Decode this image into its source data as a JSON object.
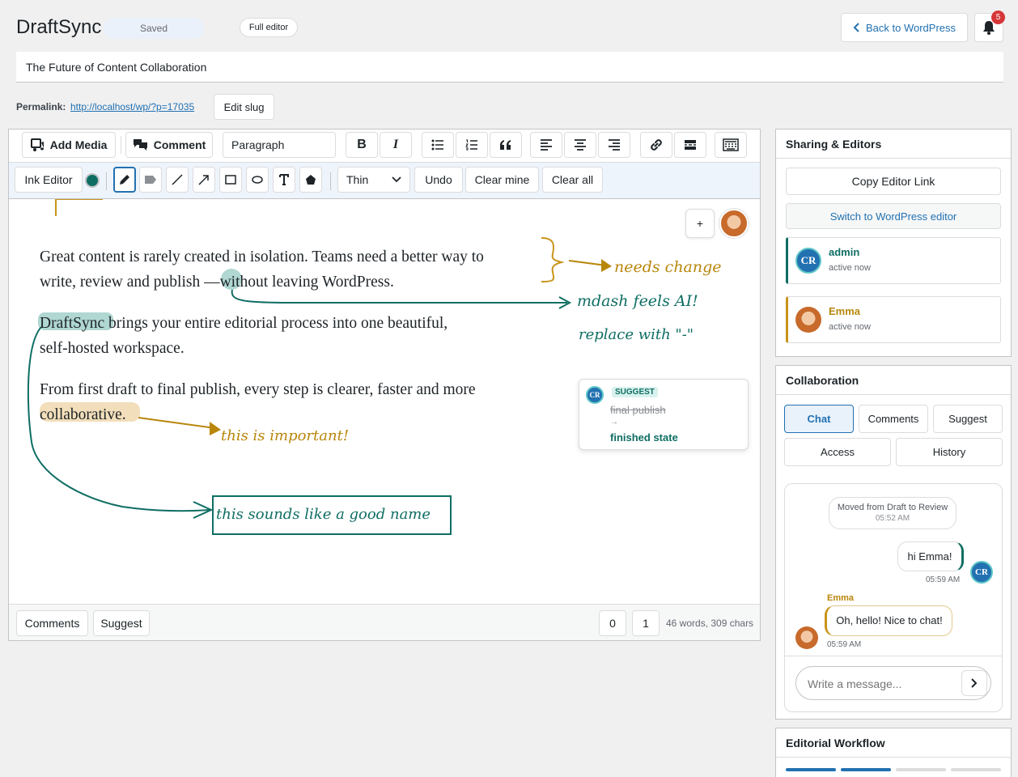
{
  "header": {
    "app_title": "DraftSync",
    "status_badge": "Saved",
    "full_editor_label": "Full editor",
    "back_label": "Back to WordPress",
    "notification_count": "5"
  },
  "post": {
    "title": "The Future of Content Collaboration",
    "permalink_label": "Permalink:",
    "permalink_url": "http://localhost/wp/?p=17035",
    "edit_slug_label": "Edit slug"
  },
  "toolbar": {
    "add_media": "Add Media",
    "comment": "Comment",
    "format_select": "Paragraph"
  },
  "ink_toolbar": {
    "ink_editor_label": "Ink Editor",
    "ink_color": "#0f6e63",
    "stroke_select": "Thin",
    "undo_label": "Undo",
    "clear_mine_label": "Clear mine",
    "clear_all_label": "Clear all"
  },
  "editor": {
    "paragraphs": [
      "Great content is rarely created in isolation. Teams need a better way to",
      "write, review and publish",
      "—",
      "without leaving WordPress.",
      "DraftSync",
      "brings your entire editorial process into one beautiful,",
      "self-hosted workspace.",
      "From first draft to final publish, every step is clearer, faster and more",
      "collaborative."
    ],
    "annotations": {
      "needs_change": "needs change",
      "mdash": "mdash feels AI!",
      "replace": "replace with \"-\"",
      "important": "this is important!",
      "good_name": "this sounds like a good name"
    },
    "plus_label": "+",
    "suggest_card": {
      "badge": "SUGGEST",
      "old_text": "final publish",
      "arrow": "→",
      "new_text": "finished state"
    }
  },
  "footer": {
    "comments_label": "Comments",
    "suggest_label": "Suggest",
    "count_a": "0",
    "count_b": "1",
    "stats": "46 words, 309 chars"
  },
  "sharing": {
    "title": "Sharing & Editors",
    "copy_link": "Copy Editor Link",
    "switch_editor": "Switch to WordPress editor",
    "editors": [
      {
        "name": "admin",
        "status": "active now",
        "initials": "CR"
      },
      {
        "name": "Emma",
        "status": "active now"
      }
    ]
  },
  "collaboration": {
    "title": "Collaboration",
    "tabs": [
      "Chat",
      "Comments",
      "Suggest",
      "Access",
      "History"
    ],
    "system_message": "Moved from Draft to Review",
    "system_time": "05:52 AM",
    "my_message": "hi Emma!",
    "my_time": "05:59 AM",
    "my_initials": "CR",
    "other_name": "Emma",
    "other_message": "Oh, hello! Nice to chat!",
    "other_time": "05:59 AM",
    "input_placeholder": "Write a message..."
  },
  "workflow": {
    "title": "Editorial Workflow",
    "steps_done": 2,
    "steps_total": 4
  },
  "colors": {
    "accent": "#2271b1",
    "teal": "#0f6e63",
    "gold": "#b8860b"
  }
}
